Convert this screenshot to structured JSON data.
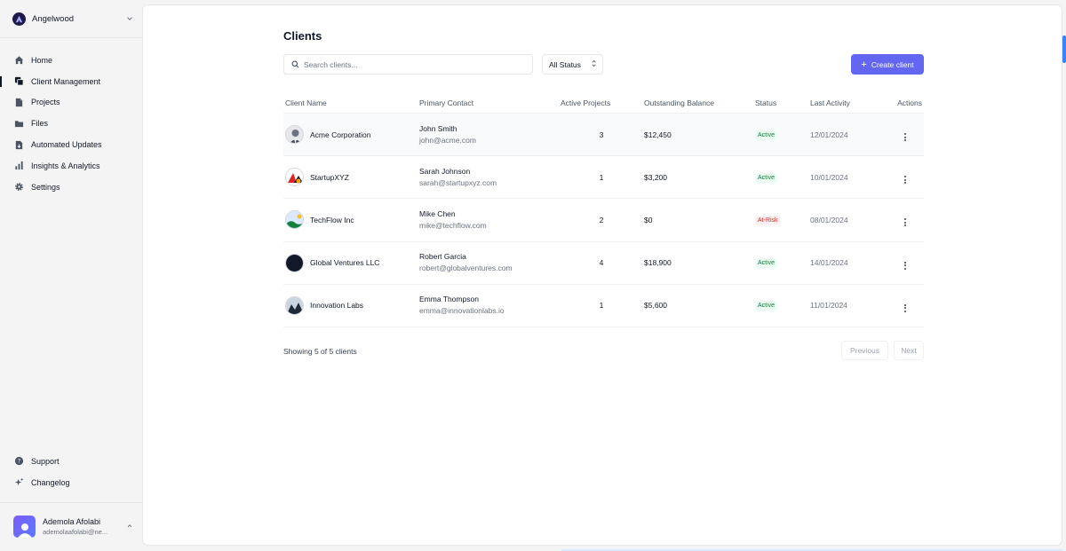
{
  "org": {
    "name": "Angelwood"
  },
  "nav": {
    "items": [
      {
        "label": "Home",
        "icon": "home-icon"
      },
      {
        "label": "Client Management",
        "icon": "clients-icon"
      },
      {
        "label": "Projects",
        "icon": "document-icon"
      },
      {
        "label": "Files",
        "icon": "folder-icon"
      },
      {
        "label": "Automated Updates",
        "icon": "file-arrow-icon"
      },
      {
        "label": "Insights & Analytics",
        "icon": "bar-chart-icon"
      },
      {
        "label": "Settings",
        "icon": "gear-icon"
      }
    ],
    "bottom": [
      {
        "label": "Support",
        "icon": "help-icon"
      },
      {
        "label": "Changelog",
        "icon": "sparkles-icon"
      }
    ]
  },
  "user": {
    "name": "Ademola Afolabi",
    "email": "ademolaafolabi@ne..."
  },
  "page": {
    "title": "Clients"
  },
  "search": {
    "placeholder": "Search clients..."
  },
  "filter": {
    "selected": "All Status"
  },
  "actions": {
    "create_label": "Create client"
  },
  "table": {
    "headers": [
      "Client Name",
      "Primary Contact",
      "Active Projects",
      "Outstanding Balance",
      "Status",
      "Last Activity",
      "Actions"
    ],
    "rows": [
      {
        "name": "Acme Corporation",
        "contact": "John Smith",
        "email": "john@acme.com",
        "projects": "3",
        "balance": "$12,450",
        "status": "Active",
        "last": "12/01/2024"
      },
      {
        "name": "StartupXYZ",
        "contact": "Sarah Johnson",
        "email": "sarah@startupxyz.com",
        "projects": "1",
        "balance": "$3,200",
        "status": "Active",
        "last": "10/01/2024"
      },
      {
        "name": "TechFlow Inc",
        "contact": "Mike Chen",
        "email": "mike@techflow.com",
        "projects": "2",
        "balance": "$0",
        "status": "At-Risk",
        "last": "08/01/2024"
      },
      {
        "name": "Global Ventures LLC",
        "contact": "Robert Garcia",
        "email": "robert@globalventures.com",
        "projects": "4",
        "balance": "$18,900",
        "status": "Active",
        "last": "14/01/2024"
      },
      {
        "name": "Innovation Labs",
        "contact": "Emma Thompson",
        "email": "emma@innovationlabs.io",
        "projects": "1",
        "balance": "$5,600",
        "status": "Active",
        "last": "11/01/2024"
      }
    ]
  },
  "footer": {
    "summary": "Showing 5 of 5 clients",
    "prev": "Previous",
    "next": "Next"
  },
  "colors": {
    "accent": "#6366f1",
    "active_bg": "#ecfdf3",
    "active_fg": "#15803d",
    "risk_bg": "#fef2f2",
    "risk_fg": "#dc2626"
  }
}
